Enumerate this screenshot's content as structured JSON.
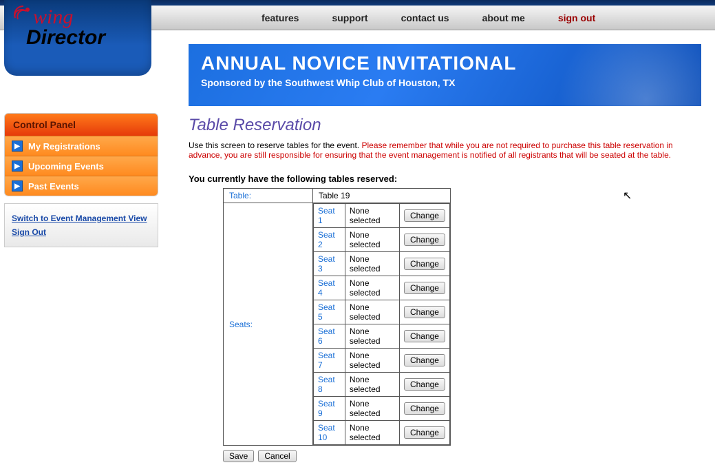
{
  "logo": {
    "top": "wing",
    "bottom": "Director"
  },
  "nav": {
    "items": [
      "features",
      "support",
      "contact us",
      "about me",
      "sign out"
    ]
  },
  "sidebar": {
    "panel_title": "Control Panel",
    "items": [
      "My Registrations",
      "Upcoming Events",
      "Past Events"
    ],
    "links": [
      "Switch to Event Management View",
      "Sign Out"
    ]
  },
  "banner": {
    "title": "ANNUAL NOVICE INVITATIONAL",
    "subtitle": "Sponsored by the Southwest Whip Club of Houston, TX"
  },
  "page": {
    "title": "Table Reservation",
    "intro_plain": "Use this screen to reserve tables for the event. ",
    "intro_warn": "Please remember that while you are not required to purchase this table reservation in advance, you are still responsible for ensuring that the event management is notified of all registrants that will be seated at the table.",
    "reserved_heading": "You currently have the following tables reserved:"
  },
  "reservation": {
    "table_label": "Table:",
    "table_name": "Table 19",
    "seats_label": "Seats:",
    "change_label": "Change",
    "seats": [
      {
        "label": "Seat 1",
        "value": "None selected"
      },
      {
        "label": "Seat 2",
        "value": "None selected"
      },
      {
        "label": "Seat 3",
        "value": "None selected"
      },
      {
        "label": "Seat 4",
        "value": "None selected"
      },
      {
        "label": "Seat 5",
        "value": "None selected"
      },
      {
        "label": "Seat 6",
        "value": "None selected"
      },
      {
        "label": "Seat 7",
        "value": "None selected"
      },
      {
        "label": "Seat 8",
        "value": "None selected"
      },
      {
        "label": "Seat 9",
        "value": "None selected"
      },
      {
        "label": "Seat 10",
        "value": "None selected"
      }
    ]
  },
  "actions": {
    "save": "Save",
    "cancel": "Cancel"
  }
}
